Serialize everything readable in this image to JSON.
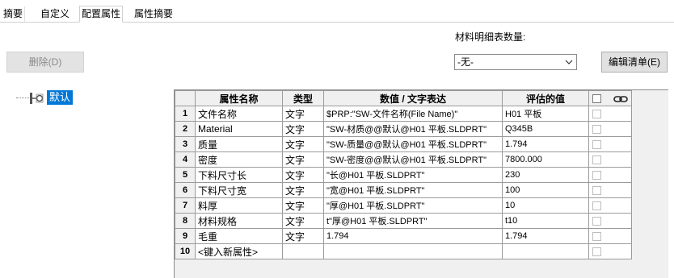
{
  "tabs": [
    {
      "label": "摘要"
    },
    {
      "label": "自定义"
    },
    {
      "label": "配置属性"
    },
    {
      "label": "属性摘要"
    }
  ],
  "active_tab": "配置属性",
  "toolbar": {
    "delete_label": "删除(D)",
    "bom_qty_label": "材料明细表数量:",
    "bom_qty_value": "-无-",
    "edit_list_label": "编辑清单(E)"
  },
  "tree": {
    "config_label": "默认"
  },
  "table": {
    "headers": {
      "name": "属性名称",
      "type": "类型",
      "value": "数值 / 文字表达",
      "evaluated": "评估的值"
    },
    "rows": [
      {
        "num": "1",
        "name": "文件名称",
        "type": "文字",
        "value": "$PRP:\"SW-文件名称(File Name)\"",
        "evaluated": "H01 平板"
      },
      {
        "num": "2",
        "name": "Material",
        "type": "文字",
        "value": "\"SW-材质@@默认@H01 平板.SLDPRT\"",
        "evaluated": "Q345B"
      },
      {
        "num": "3",
        "name": "质量",
        "type": "文字",
        "value": "\"SW-质量@@默认@H01 平板.SLDPRT\"",
        "evaluated": "1.794"
      },
      {
        "num": "4",
        "name": "密度",
        "type": "文字",
        "value": "\"SW-密度@@默认@H01 平板.SLDPRT\"",
        "evaluated": "7800.000"
      },
      {
        "num": "5",
        "name": "下料尺寸长",
        "type": "文字",
        "value": "\"长@H01 平板.SLDPRT\"",
        "evaluated": "230"
      },
      {
        "num": "6",
        "name": "下料尺寸宽",
        "type": "文字",
        "value": "\"宽@H01 平板.SLDPRT\"",
        "evaluated": "100"
      },
      {
        "num": "7",
        "name": "料厚",
        "type": "文字",
        "value": "\"厚@H01 平板.SLDPRT\"",
        "evaluated": "10"
      },
      {
        "num": "8",
        "name": "材料规格",
        "type": "文字",
        "value": "t\"厚@H01 平板.SLDPRT\"",
        "evaluated": "t10"
      },
      {
        "num": "9",
        "name": "毛重",
        "type": "文字",
        "value": "1.794",
        "evaluated": "1.794"
      },
      {
        "num": "10",
        "name": "<键入新属性>",
        "type": "",
        "value": "",
        "evaluated": ""
      }
    ]
  },
  "icons": {
    "link": "link-icon",
    "config": "configuration-icon",
    "dropdown": "chevron-down-icon"
  }
}
